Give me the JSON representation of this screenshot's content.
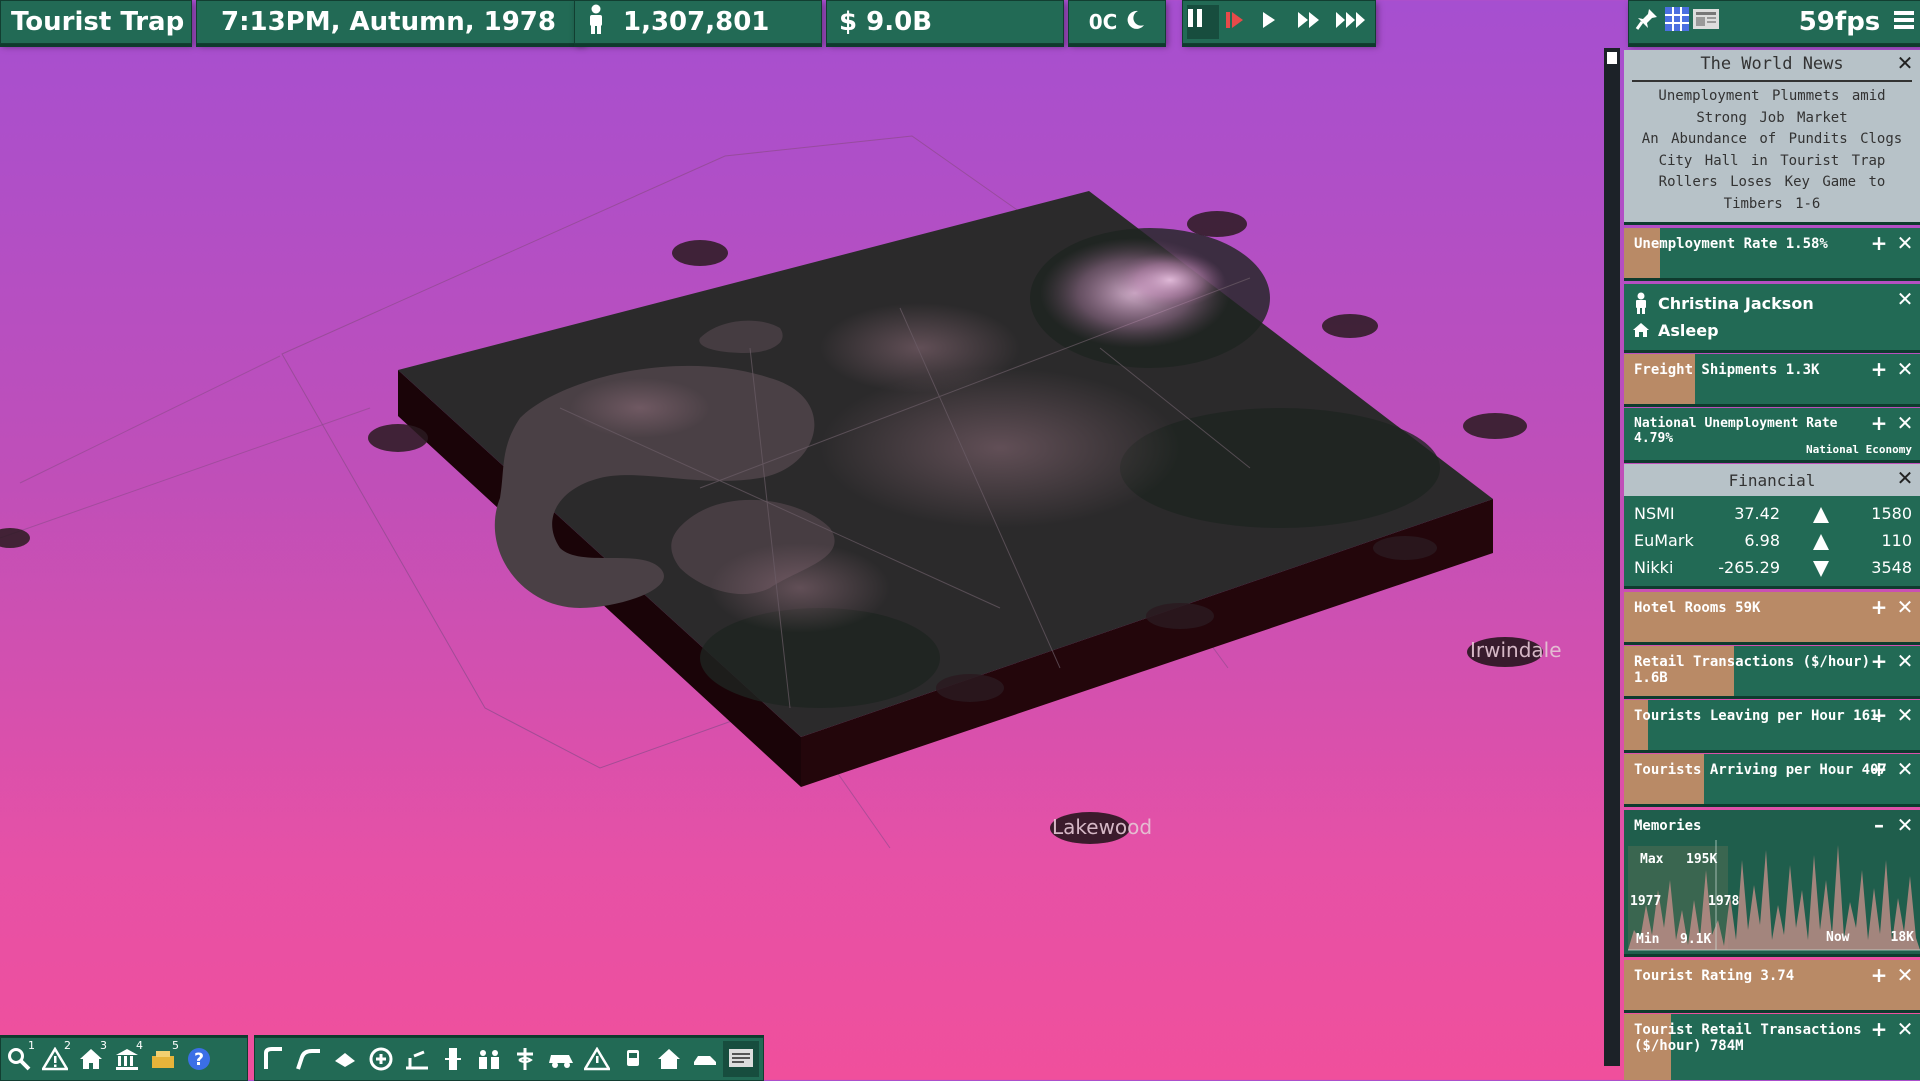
{
  "topbar": {
    "city_name": "Tourist Trap",
    "datetime": "7:13PM,  Autumn,  1978",
    "population": "1,307,801",
    "money": "$  9.0B",
    "temperature": "0C",
    "fps": "59fps"
  },
  "map_labels": {
    "irwindale": "Irwindale",
    "lakewood": "Lakewood"
  },
  "news": {
    "title": "The World News",
    "lines": [
      "Unemployment Plummets amid",
      "Strong Job Market",
      "An Abundance of Pundits Clogs",
      "City Hall in Tourist Trap",
      "Rollers Loses Key Game to",
      "Timbers 1-6"
    ]
  },
  "cards": {
    "unemployment": {
      "label": "Unemployment Rate 1.58%",
      "level": 0.12
    },
    "person": {
      "name": "Christina Jackson",
      "status": "Asleep"
    },
    "freight": {
      "label": "Freight Shipments 1.3K",
      "level": 0.24
    },
    "national": {
      "label": "National Unemployment Rate",
      "value": "4.79%",
      "tag": "National Economy",
      "level": 0.0
    },
    "hotel": {
      "label": "Hotel Rooms 59K",
      "level": 1.0
    },
    "retail": {
      "label": "Retail Transactions ($/hour)",
      "value": "1.6B",
      "level": 0.37
    },
    "leaving": {
      "label": "Tourists Leaving per Hour 161",
      "level": 0.08
    },
    "arriving": {
      "label": "Tourists Arriving per Hour 407",
      "level": 0.27
    },
    "rating": {
      "label": "Tourist Rating 3.74",
      "level": 1.0
    },
    "tourist_retail": {
      "label": "Tourist Retail Transactions",
      "value": "($/hour) 784M",
      "level": 0.16
    }
  },
  "financial": {
    "title": "Financial",
    "rows": [
      {
        "name": "NSMI",
        "value": "37.42",
        "dir": "up",
        "vol": "1580"
      },
      {
        "name": "EuMark",
        "value": "6.98",
        "dir": "up",
        "vol": "110"
      },
      {
        "name": "Nikki",
        "value": "-265.29",
        "dir": "down",
        "vol": "3548"
      }
    ]
  },
  "memories": {
    "title": "Memories",
    "max_label": "Max",
    "max_value": "195K",
    "min_label": "Min",
    "min_value": "9.1K",
    "year1": "1977",
    "year2": "1978",
    "now_label": "Now",
    "now_value": "18K"
  },
  "colors": {
    "bar": "#226a55",
    "accent": "#b98a66",
    "sky_top": "#a64fd0",
    "sky_bottom": "#f04f9c"
  }
}
